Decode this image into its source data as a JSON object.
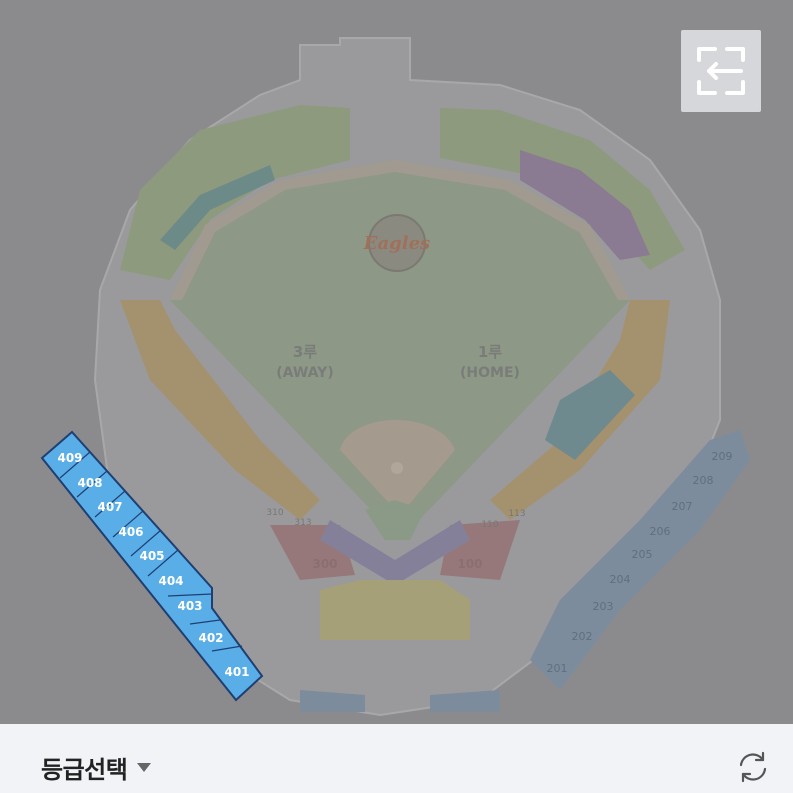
{
  "map": {
    "team_logo_text": "Eagles",
    "field_labels": {
      "third_base_name": "3루",
      "third_base_side": "(AWAY)",
      "first_base_name": "1루",
      "first_base_side": "(HOME)"
    },
    "highlighted_sections": [
      "409",
      "408",
      "407",
      "406",
      "405",
      "404",
      "403",
      "402",
      "401"
    ],
    "infield_section_labels": [
      "300",
      "100",
      "310",
      "110",
      "313",
      "113"
    ],
    "right_sections": [
      "209",
      "208",
      "207",
      "206",
      "205",
      "204",
      "203",
      "202",
      "201"
    ],
    "colors": {
      "overlay": "#8b8b8d",
      "highlight_fill": "#5aaee7",
      "highlight_stroke": "#1f3f73",
      "highlight_text": "#ffffff"
    }
  },
  "exit_button": {
    "icon": "exit-fullscreen-icon"
  },
  "bottom_bar": {
    "grade_select_label": "등급선택",
    "caret_icon": "caret-down-icon",
    "refresh_icon": "refresh-icon"
  }
}
